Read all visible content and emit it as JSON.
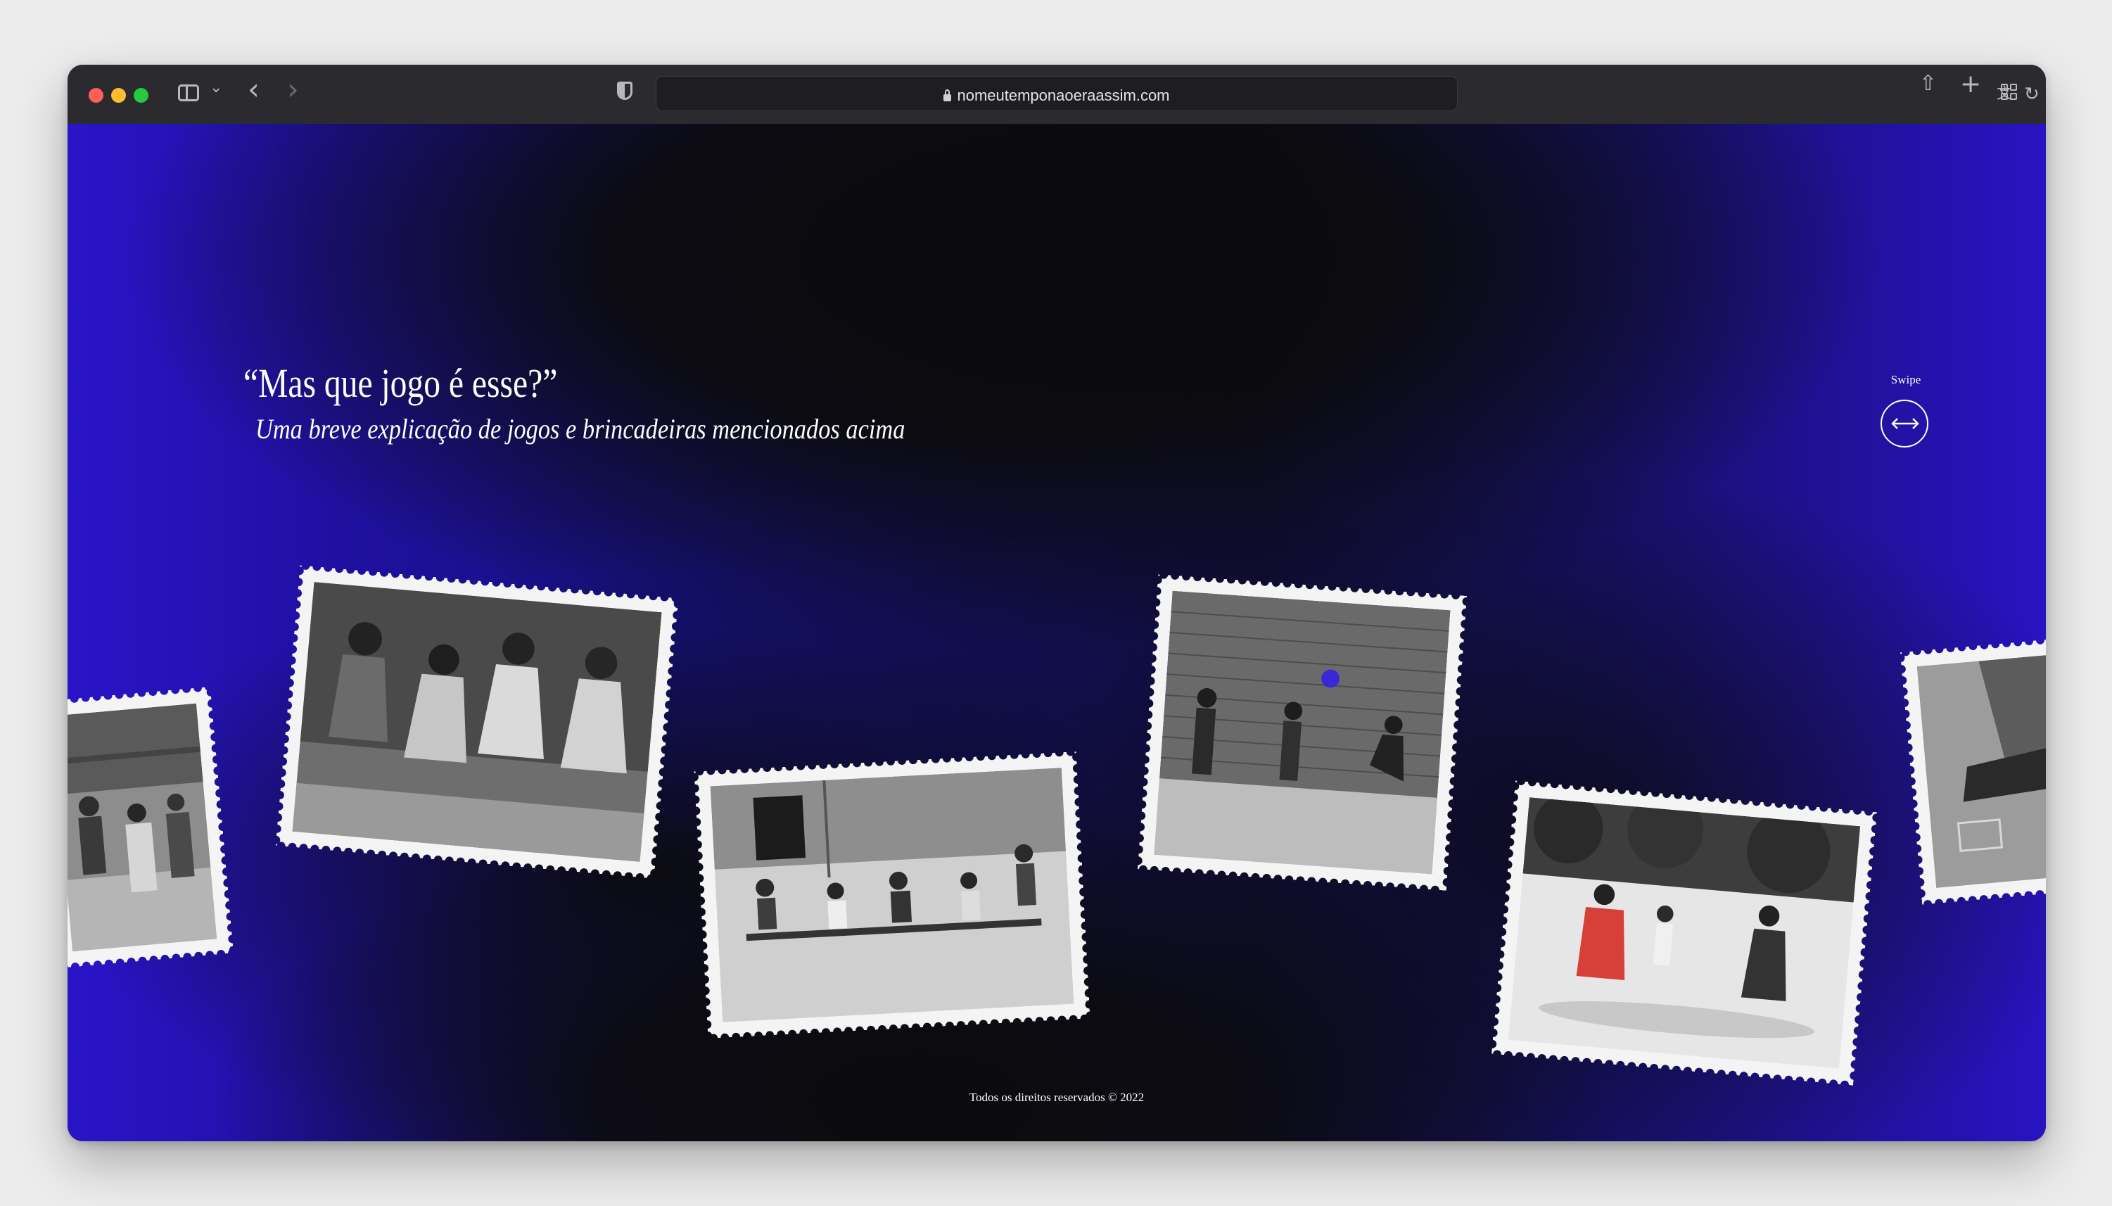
{
  "browser": {
    "url": "nomeutemponaoeraassim.com"
  },
  "page": {
    "headline": "“Mas que jogo é esse?”",
    "subheadline": "Uma breve explicação de jogos e brincadeiras mencionados acima",
    "swipe_label": "Swipe",
    "footer": "Todos os direitos reservados © 2022"
  },
  "colors": {
    "accent": "#2a14c8",
    "background": "#0b0b0d",
    "text": "#ffffff"
  },
  "icons": {
    "swipe": "horizontal-arrows-icon",
    "toolbar": [
      "sidebar-icon",
      "chevron-down-icon",
      "back-icon",
      "forward-icon",
      "shield-icon",
      "lock-icon",
      "translate-icon",
      "reload-icon",
      "share-icon",
      "new-tab-icon",
      "tab-overview-icon"
    ]
  }
}
